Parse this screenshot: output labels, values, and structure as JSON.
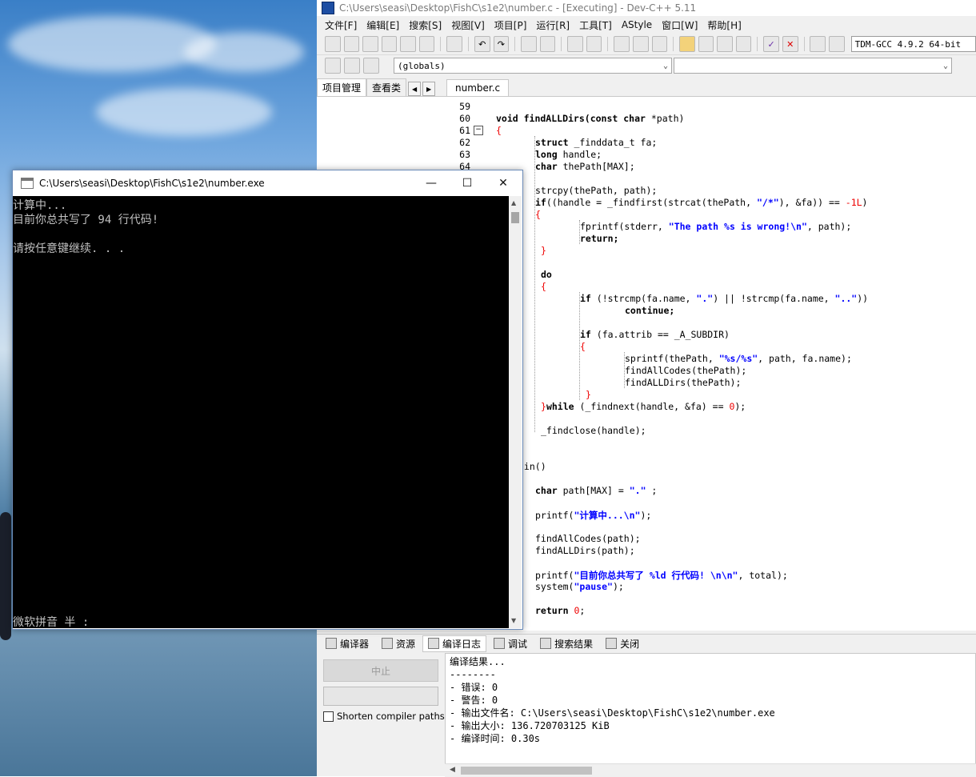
{
  "ide": {
    "title": "C:\\Users\\seasi\\Desktop\\FishC\\s1e2\\number.c - [Executing] - Dev-C++ 5.11",
    "menu": [
      "文件[F]",
      "编辑[E]",
      "搜索[S]",
      "视图[V]",
      "项目[P]",
      "运行[R]",
      "工具[T]",
      "AStyle",
      "窗口[W]",
      "帮助[H]"
    ],
    "compiler": "TDM-GCC 4.9.2 64-bit",
    "scope_combo": "(globals)",
    "symbol_combo": "",
    "left_tabs": [
      "项目管理",
      "查看类"
    ],
    "editor_tab": "number.c",
    "line_numbers": [
      "59",
      "60",
      "61",
      "62",
      "63",
      "64"
    ],
    "fold_marker": "−",
    "code": {
      "l60a": "void findALLDirs(",
      "l60b": "const char",
      "l60c": " *path)",
      "l61": "{",
      "l62a": "struct",
      "l62b": " _finddata_t fa;",
      "l63a": "long",
      "l63b": " handle;",
      "l64a": "char",
      "l64b": " thePath[MAX];",
      "l66": "strcpy(thePath, path);",
      "l67a": "if",
      "l67b": "((handle = _findfirst(strcat(thePath, ",
      "l67c": "\"/*\"",
      "l67d": "), &fa)) == ",
      "l67e": "-1L",
      "l67f": ")",
      "l68": "{",
      "l69a": "fprintf(stderr, ",
      "l69b": "\"The path %s is wrong!\\n\"",
      "l69c": ", path);",
      "l70": "return;",
      "l71": "}",
      "l73": "do",
      "l74": "{",
      "l75a": "if",
      "l75b": " (!strcmp(fa.name, ",
      "l75c": "\".\"",
      "l75d": ") || !strcmp(fa.name, ",
      "l75e": "\"..\"",
      "l75f": "))",
      "l76": "continue;",
      "l78a": "if",
      "l78b": " (fa.attrib == _A_SUBDIR)",
      "l79": "{",
      "l80a": "sprintf(thePath, ",
      "l80b": "\"%s/%s\"",
      "l80c": ", path, fa.name);",
      "l81": "findAllCodes(thePath);",
      "l82": "findALLDirs(thePath);",
      "l83": "}",
      "l84a": "}",
      "l84b": "while",
      "l84c": " (_findnext(handle, &fa) == ",
      "l84d": "0",
      "l84e": ");",
      "l86": "_findclose(handle);",
      "l89": "ain()",
      "l91a": "char",
      "l91b": " path[MAX] = ",
      "l91c": "\".\"",
      "l91d": " ;",
      "l93a": "printf(",
      "l93b": "\"计算中...\\n\"",
      "l93c": ");",
      "l95": "findAllCodes(path);",
      "l96": "findALLDirs(path);",
      "l98a": "printf(",
      "l98b": "\"目前你总共写了 %ld 行代码! \\n\\n\"",
      "l98c": ", total);",
      "l99a": "system(",
      "l99b": "\"pause\"",
      "l99c": ");",
      "l101a": "return",
      "l101b": " 0",
      "l101c": ";"
    },
    "bottom_tabs": [
      "编译器",
      "资源",
      "编译日志",
      "调试",
      "搜索结果",
      "关闭"
    ],
    "stop_label": "中止",
    "shorten_label": "Shorten compiler paths",
    "log": [
      "编译结果...",
      "--------",
      "- 错误: 0",
      "- 警告: 0",
      "- 输出文件名: C:\\Users\\seasi\\Desktop\\FishC\\s1e2\\number.exe",
      "- 输出大小: 136.720703125 KiB",
      "- 编译时间: 0.30s"
    ]
  },
  "console": {
    "title": "C:\\Users\\seasi\\Desktop\\FishC\\s1e2\\number.exe",
    "lines": [
      "计算中...",
      "目前你总共写了 94 行代码!",
      "",
      "请按任意键继续. . ."
    ],
    "ime_status": "微软拼音 半 :"
  }
}
